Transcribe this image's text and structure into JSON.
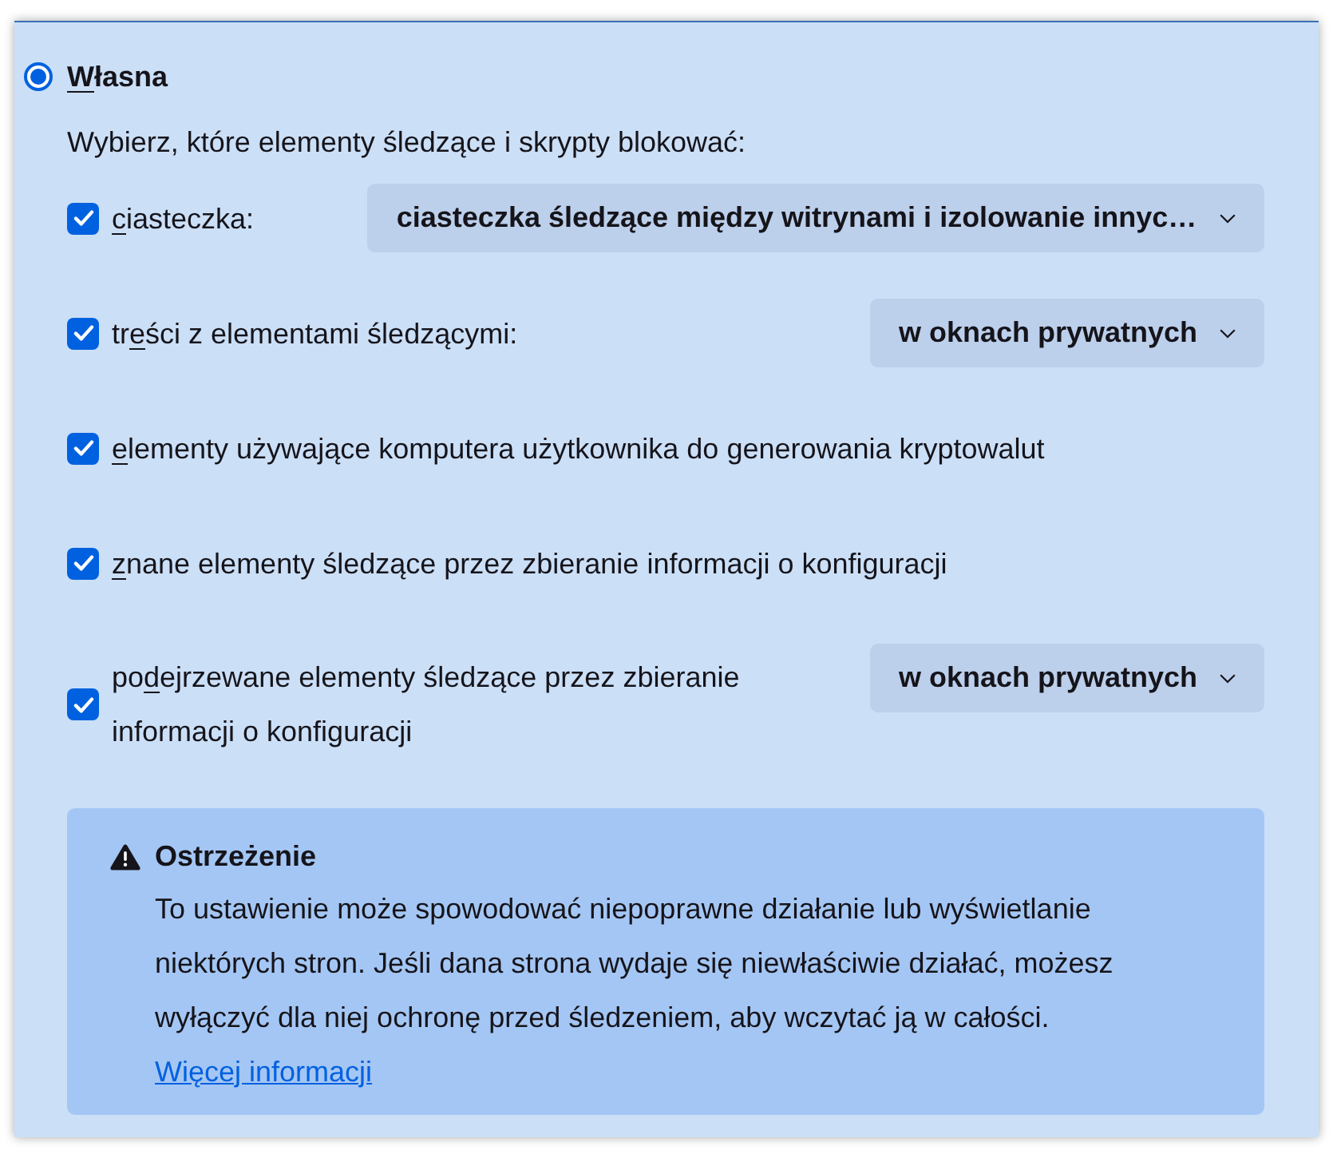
{
  "option": {
    "access_key": "W",
    "after": "łasna",
    "selected": true
  },
  "intro": "Wybierz, które elementy śledzące i skrypty blokować:",
  "items": [
    {
      "kind": "wide",
      "access_key": "c",
      "after": "iasteczka:",
      "checked": true,
      "select": "ciasteczka śledzące między witrynami i izolowanie innyc…"
    },
    {
      "kind": "select",
      "before": "tr",
      "access_key": "e",
      "after": "ści z elementami śledzącymi:",
      "checked": true,
      "select": "w oknach prywatnych"
    },
    {
      "kind": "plain",
      "access_key": "e",
      "after": "lementy używające komputera użytkownika do generowania kryptowalut",
      "checked": true
    },
    {
      "kind": "plain",
      "access_key": "z",
      "after": "nane elementy śledzące przez zbieranie informacji o konfiguracji",
      "checked": true
    },
    {
      "kind": "select",
      "before": "po",
      "access_key": "d",
      "after": "ejrzewane elementy śledzące przez zbieranie informacji o konfiguracji",
      "checked": true,
      "select": "w oknach prywatnych"
    }
  ],
  "warning": {
    "title": "Ostrzeżenie",
    "body": "To ustawienie może spowodować niepoprawne działanie lub wyświetlanie niektórych stron. Jeśli dana strona wydaje się niewłaściwie działać, możesz wyłączyć dla niej ochronę przed śledzeniem, aby wczytać ją w całości.",
    "link": "Więcej informacji"
  }
}
